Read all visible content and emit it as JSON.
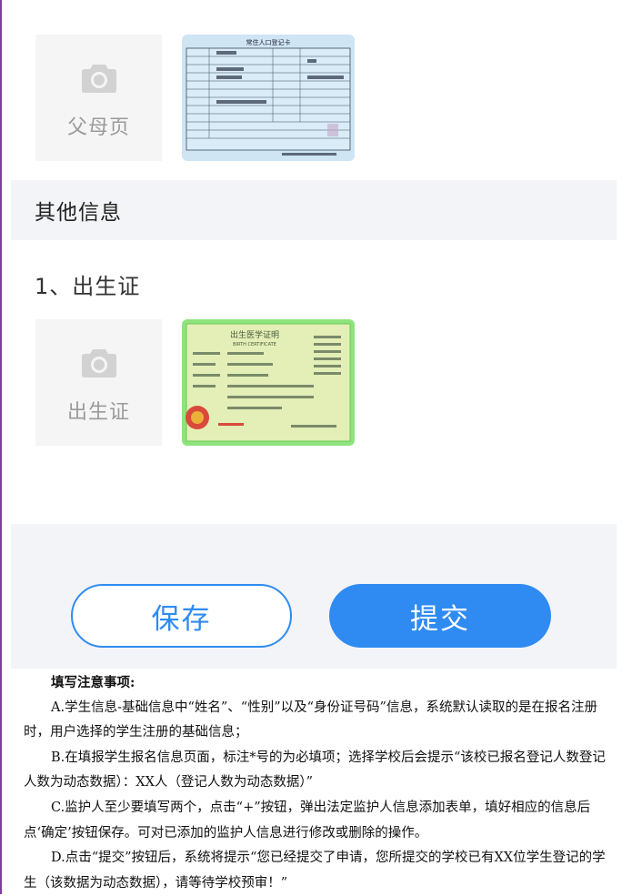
{
  "photos": [
    {
      "label": "父母页",
      "thumbnail": "户口本常住人口登记卡照片",
      "card_title": "常住人口登记卡"
    },
    {
      "label": "出生证",
      "thumbnail": "出生医学证明照片",
      "card_title": "出生医学证明",
      "card_subtitle": "BIRTH CERTIFICATE"
    }
  ],
  "section": {
    "title": "其他信息"
  },
  "item": {
    "title": "1、出生证"
  },
  "buttons": {
    "save": "保存",
    "submit": "提交"
  },
  "notes": {
    "title": "填写注意事项:",
    "paragraphs": [
      "A.学生信息-基础信息中“姓名”、“性别”以及“身份证号码”信息，系统默认读取的是在报名注册时，用户选择的学生注册的基础信息；",
      "B.在填报学生报名信息页面，标注*号的为必填项；选择学校后会提示“该校已报名登记人数登记人数为动态数据）：XX人（登记人数为动态数据）”",
      "C.监护人至少要填写两个，点击“+”按钮，弹出法定监护人信息添加表单，填好相应的信息后点‘确定’按钮保存。可对已添加的监护人信息进行修改或删除的操作。",
      "D.点击“提交”按钮后，系统将提示“您已经提交了申请，您所提交的学校已有XX位学生登记的学生（该数据为动态数据），请等待学校预审！”"
    ]
  },
  "colors": {
    "primary": "#2f8bf2",
    "section_bg": "#f3f4f7",
    "placeholder_bg": "#f5f5f6",
    "frame_line": "#7e3e9a"
  }
}
